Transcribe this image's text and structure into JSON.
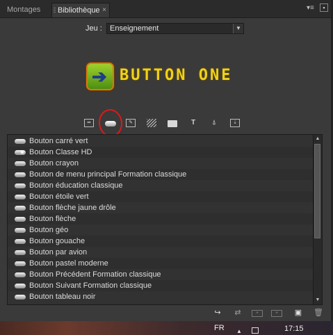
{
  "tabs": [
    {
      "label": "Montages",
      "active": false
    },
    {
      "label": "Bibliothèque",
      "active": true
    }
  ],
  "tab_close_glyph": "×",
  "panel_menu_glyph": "▾≡",
  "jeu": {
    "label": "Jeu :",
    "value": "Enseignement"
  },
  "preview": {
    "text": "BUTTON ONE",
    "icon": "green-arrow-button-icon"
  },
  "colors": {
    "accent_preview_text": "#f0d218",
    "highlight_circle": "#e01818",
    "panel_bg": "#3a3a3a"
  },
  "category_toolbar": [
    {
      "name": "frames-icon"
    },
    {
      "name": "buttons-icon",
      "selected": true
    },
    {
      "name": "edit-image-icon"
    },
    {
      "name": "backgrounds-icon"
    },
    {
      "name": "folder-icon"
    },
    {
      "name": "text-icon",
      "glyph": "T"
    },
    {
      "name": "brush-icon"
    },
    {
      "name": "download-icon"
    }
  ],
  "items": [
    {
      "label": "Bouton carré vert"
    },
    {
      "label": "Bouton Classe HD",
      "starred": true
    },
    {
      "label": "Bouton crayon"
    },
    {
      "label": "Bouton de menu principal Formation classique"
    },
    {
      "label": "Bouton éducation classique"
    },
    {
      "label": "Bouton étoile vert"
    },
    {
      "label": "Bouton flèche jaune drôle"
    },
    {
      "label": "Bouton flèche"
    },
    {
      "label": "Bouton géo"
    },
    {
      "label": "Bouton gouache"
    },
    {
      "label": "Bouton par avion"
    },
    {
      "label": "Bouton pastel moderne"
    },
    {
      "label": "Bouton Précédent Formation classique"
    },
    {
      "label": "Bouton Suivant Formation classique"
    },
    {
      "label": "Bouton tableau noir"
    }
  ],
  "bottom_toolbar": [
    "apply-icon",
    "replace-icon",
    "add-to-layer-icon",
    "add-to-menu-icon",
    "new-icon",
    "trash-icon"
  ],
  "taskbar": {
    "language": "FR",
    "time": "17:15"
  }
}
